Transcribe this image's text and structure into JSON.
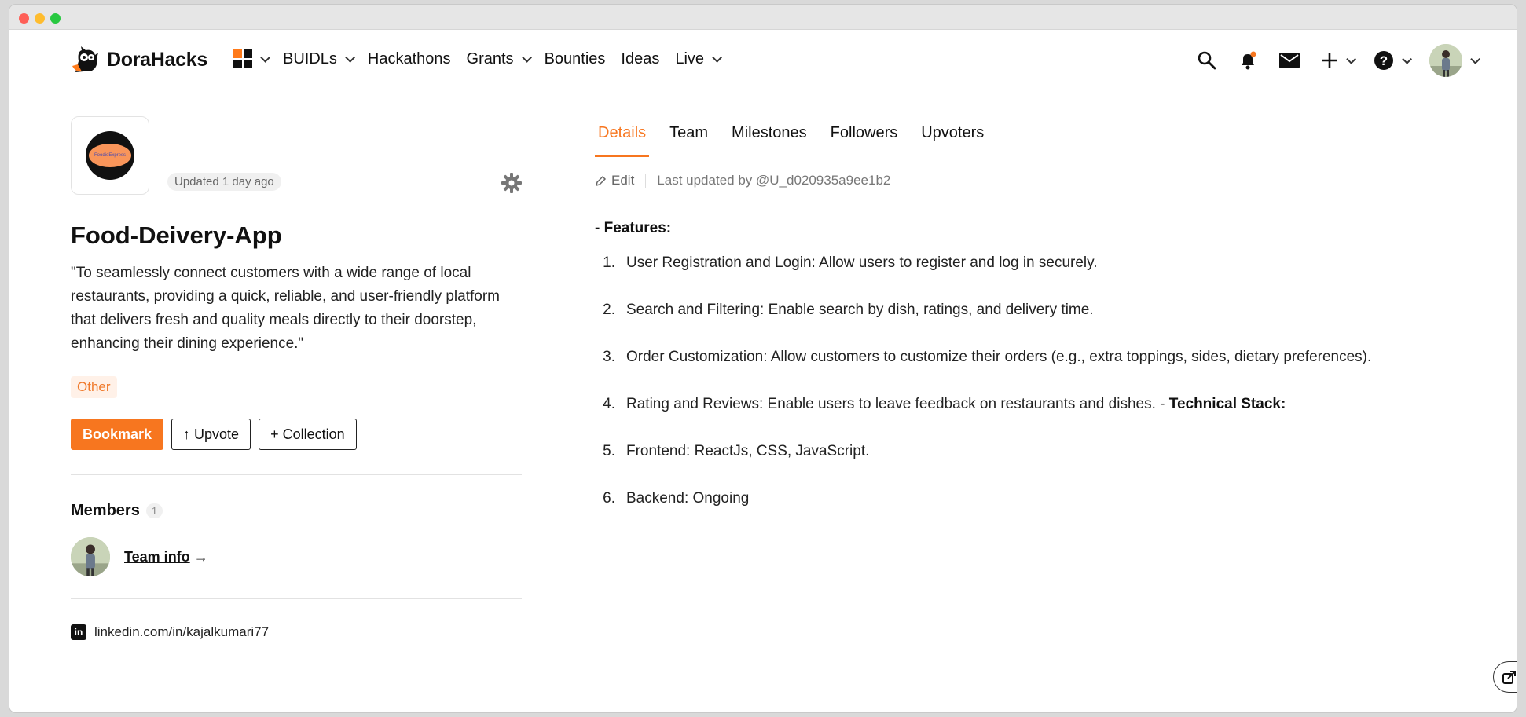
{
  "brand": {
    "name": "DoraHacks"
  },
  "nav": {
    "items": [
      {
        "label": "BUIDLs",
        "dropdown": true
      },
      {
        "label": "Hackathons",
        "dropdown": false
      },
      {
        "label": "Grants",
        "dropdown": true
      },
      {
        "label": "Bounties",
        "dropdown": false
      },
      {
        "label": "Ideas",
        "dropdown": false
      },
      {
        "label": "Live",
        "dropdown": true
      }
    ],
    "right_icons": [
      "search-icon",
      "bell-icon",
      "mail-icon",
      "plus-icon",
      "help-icon"
    ]
  },
  "project": {
    "logo_text": "FoodieExpress",
    "updated": "Updated 1 day ago",
    "title": "Food-Deivery-App",
    "description": "\"To seamlessly connect customers with a wide range of local restaurants, providing a quick, reliable, and user-friendly platform that delivers fresh and quality meals directly to their doorstep, enhancing their dining experience.\"",
    "tag": "Other",
    "actions": {
      "bookmark": "Bookmark",
      "upvote": "↑ Upvote",
      "collection": "+ Collection"
    }
  },
  "members": {
    "heading": "Members",
    "count": "1",
    "team_link": "Team info",
    "arrow": "→"
  },
  "social": {
    "linkedin": "linkedin.com/in/kajalkumari77"
  },
  "tabs": [
    "Details",
    "Team",
    "Milestones",
    "Followers",
    "Upvoters"
  ],
  "details": {
    "edit_label": "Edit",
    "last_updated": "Last updated by @U_d020935a9ee1b2",
    "features_title": "- Features:",
    "features": [
      {
        "num": "1.",
        "text": "User Registration and Login: Allow users to register and log in securely.",
        "bold": ""
      },
      {
        "num": "2.",
        "text": "Search and Filtering: Enable search by dish, ratings, and delivery time.",
        "bold": ""
      },
      {
        "num": "3.",
        "text": "Order Customization: Allow customers to customize their orders (e.g., extra toppings, sides, dietary preferences).",
        "bold": ""
      },
      {
        "num": "4.",
        "text": "Rating and Reviews: Enable users to leave feedback on restaurants and dishes. - ",
        "bold": "Technical Stack:"
      },
      {
        "num": "5.",
        "text": "Frontend: ReactJs, CSS, JavaScript.",
        "bold": ""
      },
      {
        "num": "6.",
        "text": "Backend: Ongoing",
        "bold": ""
      }
    ]
  },
  "colors": {
    "accent": "#f7761f",
    "tag_bg": "#fff1e8"
  }
}
